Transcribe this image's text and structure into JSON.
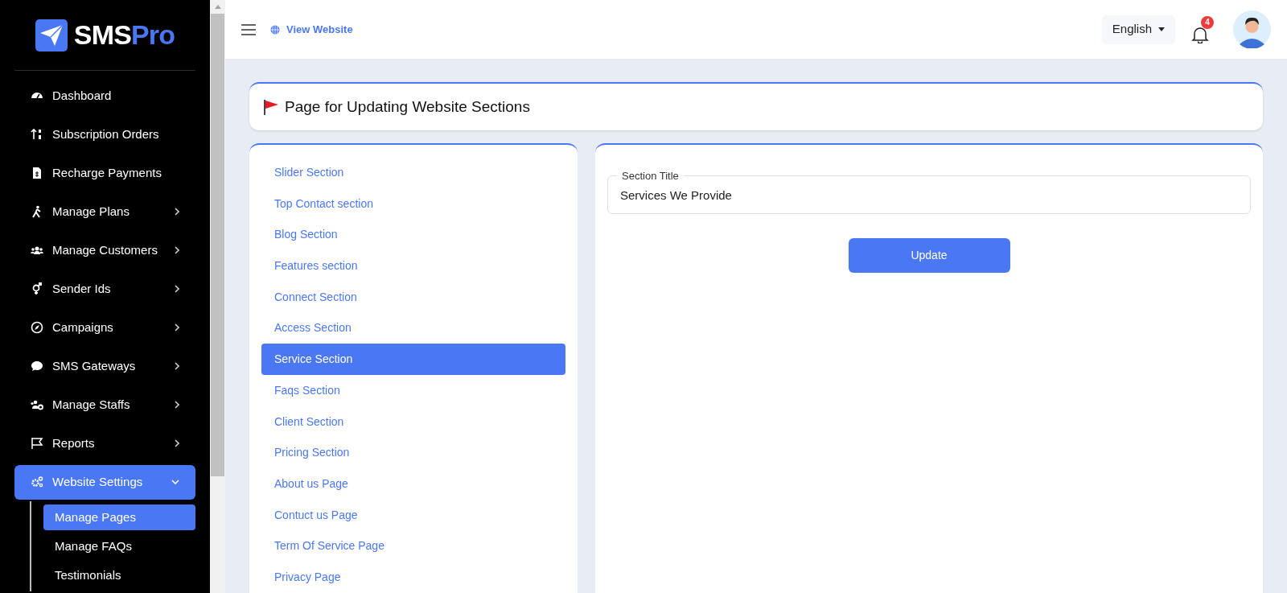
{
  "brand": {
    "part_1": "SMS",
    "part_2": "Pro"
  },
  "sidebar": {
    "items": [
      {
        "label": "Dashboard",
        "kind": "link",
        "selected": false
      },
      {
        "label": "Subscription Orders",
        "kind": "link",
        "selected": false
      },
      {
        "label": "Recharge Payments",
        "kind": "link",
        "selected": false
      },
      {
        "label": "Manage Plans",
        "kind": "group",
        "selected": false,
        "expanded": false
      },
      {
        "label": "Manage Customers",
        "kind": "group",
        "selected": false,
        "expanded": false
      },
      {
        "label": "Sender Ids",
        "kind": "group",
        "selected": false,
        "expanded": false
      },
      {
        "label": "Campaigns",
        "kind": "group",
        "selected": false,
        "expanded": false
      },
      {
        "label": "SMS Gateways",
        "kind": "group",
        "selected": false,
        "expanded": false
      },
      {
        "label": "Manage Staffs",
        "kind": "group",
        "selected": false,
        "expanded": false
      },
      {
        "label": "Reports",
        "kind": "group",
        "selected": false,
        "expanded": false
      },
      {
        "label": "Website Settings",
        "kind": "group",
        "selected": true,
        "expanded": true,
        "children": [
          {
            "label": "Manage Pages",
            "selected": true
          },
          {
            "label": "Manage FAQs",
            "selected": false
          },
          {
            "label": "Testimonials",
            "selected": false
          }
        ]
      }
    ]
  },
  "topbar": {
    "view_website": "View Website",
    "language": "English",
    "notification_count": "4"
  },
  "page_title": "Page for Updating Website Sections",
  "sections": [
    {
      "label": "Slider Section",
      "selected": false
    },
    {
      "label": "Top Contact section",
      "selected": false
    },
    {
      "label": "Blog Section",
      "selected": false
    },
    {
      "label": "Features section",
      "selected": false
    },
    {
      "label": "Connect Section",
      "selected": false
    },
    {
      "label": "Access Section",
      "selected": false
    },
    {
      "label": "Service Section",
      "selected": true
    },
    {
      "label": "Faqs Section",
      "selected": false
    },
    {
      "label": "Client Section",
      "selected": false
    },
    {
      "label": "Pricing Section",
      "selected": false
    },
    {
      "label": "About us Page",
      "selected": false
    },
    {
      "label": "Contuct us Page",
      "selected": false
    },
    {
      "label": "Term Of Service Page",
      "selected": false
    },
    {
      "label": "Privacy Page",
      "selected": false
    }
  ],
  "form": {
    "field_label": "Section Title",
    "field_value": "Services We Provide",
    "button": "Update"
  }
}
